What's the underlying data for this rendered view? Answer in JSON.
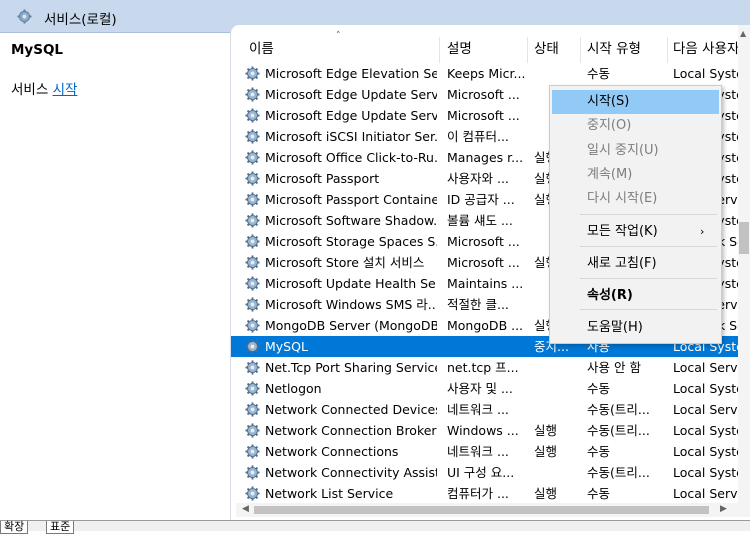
{
  "header": {
    "title": "서비스(로컬)",
    "icon": "gear-icon"
  },
  "left_pane": {
    "service_name": "MySQL",
    "action_prefix": "서비스 ",
    "action_link": "시작"
  },
  "columns": {
    "name": "이름",
    "desc": "설명",
    "status": "상태",
    "startup": "시작 유형",
    "logon": "다음 사용자"
  },
  "rows": [
    {
      "name": "Microsoft Edge Elevation Se...",
      "desc": "Keeps Micr...",
      "status": "",
      "startup": "수동",
      "logon": "Local Syste"
    },
    {
      "name": "Microsoft Edge Update Serv...",
      "desc": "Microsoft ...",
      "status": "",
      "startup": "수동",
      "logon": "Local Syste"
    },
    {
      "name": "Microsoft Edge Update Serv...",
      "desc": "Microsoft ...",
      "status": "",
      "startup": "수동",
      "logon": "Local Syste"
    },
    {
      "name": "Microsoft iSCSI Initiator Ser...",
      "desc": "이 컴퓨터...",
      "status": "",
      "startup": "수동",
      "logon": "Local Syste"
    },
    {
      "name": "Microsoft Office Click-to-Ru...",
      "desc": "Manages r...",
      "status": "실행",
      "startup": "자동",
      "logon": "Local Syste"
    },
    {
      "name": "Microsoft Passport",
      "desc": "사용자와 ...",
      "status": "실행",
      "startup": "수동",
      "logon": "Local Syste"
    },
    {
      "name": "Microsoft Passport Container",
      "desc": "ID 공급자 ...",
      "status": "실행",
      "startup": "수동",
      "logon": "Local Servi"
    },
    {
      "name": "Microsoft Software Shadow...",
      "desc": "볼륨 섀도 ...",
      "status": "",
      "startup": "수동",
      "logon": "Local Syste"
    },
    {
      "name": "Microsoft Storage Spaces S...",
      "desc": "Microsoft ...",
      "status": "",
      "startup": "수동",
      "logon": "Network Se"
    },
    {
      "name": "Microsoft Store 설치 서비스",
      "desc": "Microsoft ...",
      "status": "실행",
      "startup": "수동",
      "logon": "Local Syste"
    },
    {
      "name": "Microsoft Update Health Se...",
      "desc": "Maintains ...",
      "status": "",
      "startup": "수동",
      "logon": "Local Syste"
    },
    {
      "name": "Microsoft Windows SMS 라...",
      "desc": "적절한 클...",
      "status": "",
      "startup": "수동",
      "logon": "Local Servi"
    },
    {
      "name": "MongoDB Server (MongoDB)",
      "desc": "MongoDB ...",
      "status": "실행",
      "startup": "자동",
      "logon": "Network Se"
    },
    {
      "name": "MySQL",
      "desc": "",
      "status": "중지...",
      "startup": "사용",
      "logon": "Local Syste",
      "selected": true
    },
    {
      "name": "Net.Tcp Port Sharing Service",
      "desc": "net.tcp 프...",
      "status": "",
      "startup": "사용 안 함",
      "logon": "Local Servi"
    },
    {
      "name": "Netlogon",
      "desc": "사용자 및 ...",
      "status": "",
      "startup": "수동",
      "logon": "Local Syste"
    },
    {
      "name": "Network Connected Devices...",
      "desc": "네트워크 ...",
      "status": "",
      "startup": "수동(트리...",
      "logon": "Local Servi"
    },
    {
      "name": "Network Connection Broker",
      "desc": "Windows ...",
      "status": "실행",
      "startup": "수동(트리...",
      "logon": "Local Syste"
    },
    {
      "name": "Network Connections",
      "desc": "네트워크 ...",
      "status": "실행",
      "startup": "수동",
      "logon": "Local Syste"
    },
    {
      "name": "Network Connectivity Assist...",
      "desc": "UI 구성 요...",
      "status": "",
      "startup": "수동(트리...",
      "logon": "Local Syste"
    },
    {
      "name": "Network List Service",
      "desc": "컴퓨터가 ...",
      "status": "실행",
      "startup": "수동",
      "logon": "Local Servi"
    }
  ],
  "context_menu": [
    {
      "label": "시작(S)",
      "state": "highlight"
    },
    {
      "label": "중지(O)",
      "state": "disabled"
    },
    {
      "label": "일시 중지(U)",
      "state": "disabled"
    },
    {
      "label": "계속(M)",
      "state": "disabled"
    },
    {
      "label": "다시 시작(E)",
      "state": "disabled"
    },
    {
      "label": "모든 작업(K)",
      "state": "normal",
      "submenu": true
    },
    {
      "label": "새로 고침(F)",
      "state": "normal"
    },
    {
      "label": "속성(R)",
      "state": "bold"
    },
    {
      "label": "도움말(H)",
      "state": "normal"
    }
  ],
  "bottom_tabs": [
    "확장",
    "표준"
  ],
  "colors": {
    "selection": "#0078d7",
    "menu_highlight": "#91c9f7",
    "header_bar": "#c9d9ed",
    "link": "#0066cc"
  }
}
